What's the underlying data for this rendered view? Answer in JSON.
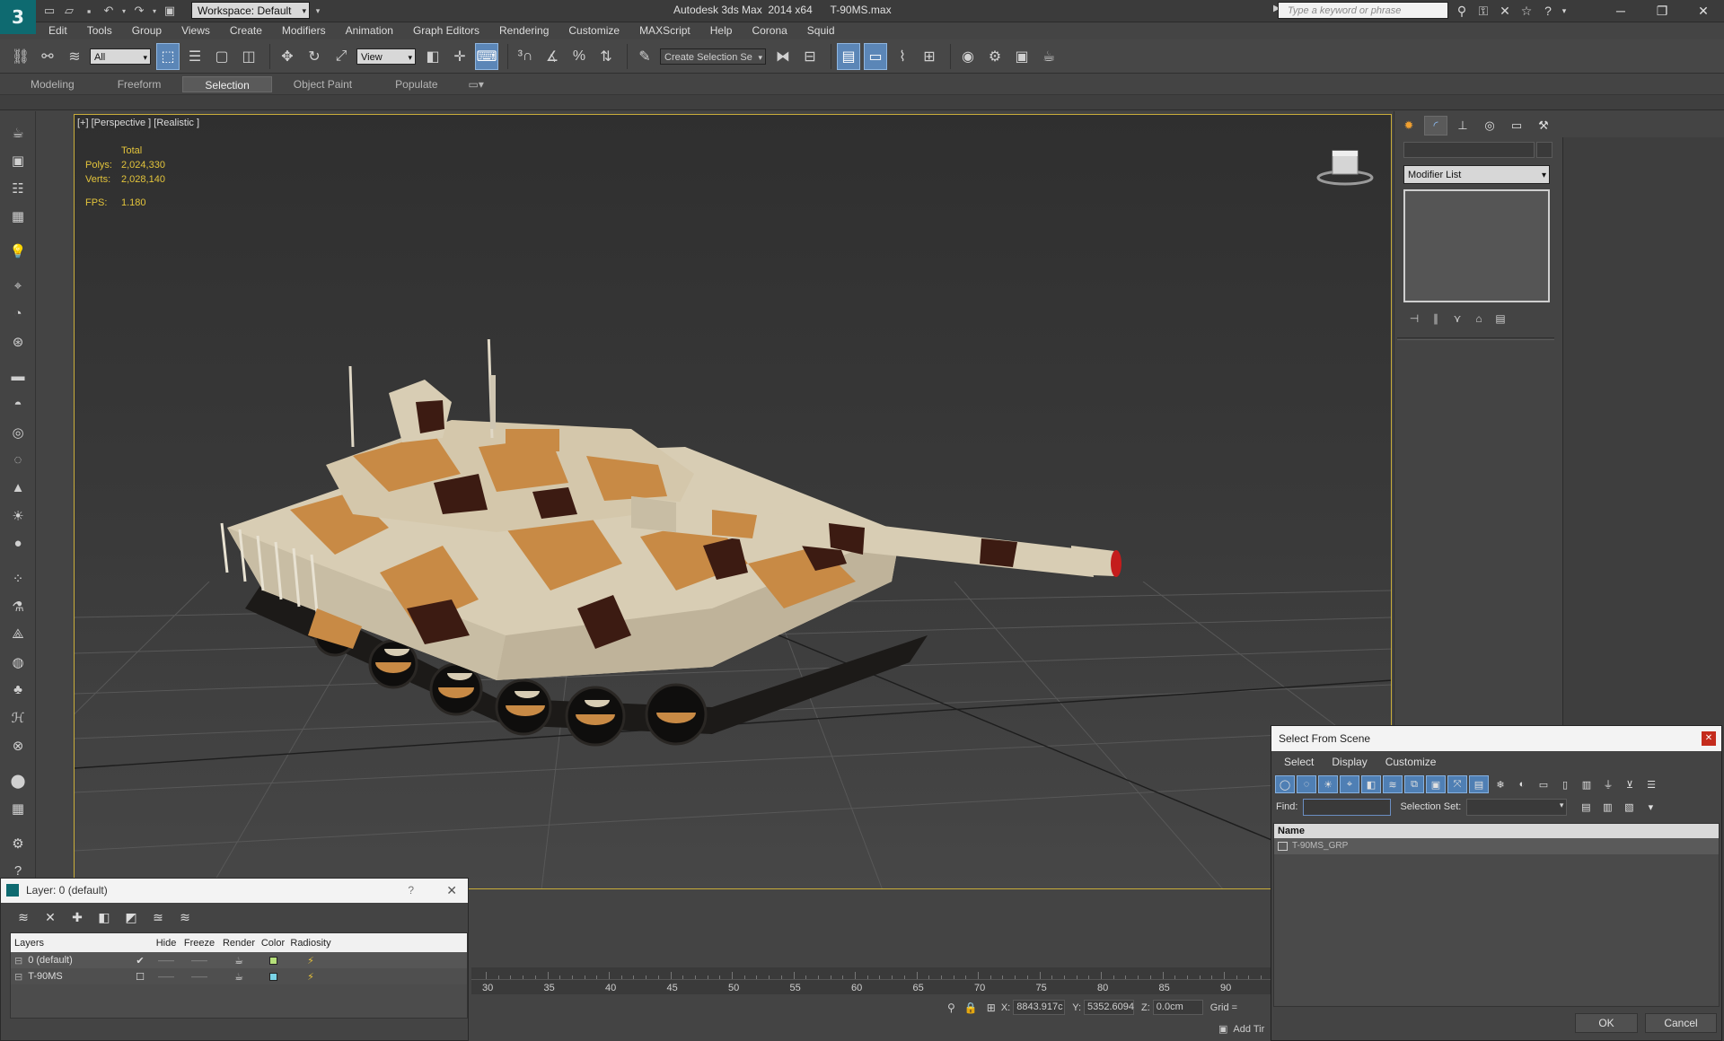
{
  "titlebar": {
    "workspace": "Workspace: Default",
    "title": "Autodesk 3ds Max  2014 x64      T-90MS.max",
    "search_placeholder": "Type a keyword or phrase"
  },
  "menu": [
    "Edit",
    "Tools",
    "Group",
    "Views",
    "Create",
    "Modifiers",
    "Animation",
    "Graph Editors",
    "Rendering",
    "Customize",
    "MAXScript",
    "Help",
    "Corona",
    "Squid"
  ],
  "toolbar": {
    "selection_filter": "All",
    "ref_coord": "View",
    "named_selection_placeholder": "Create Selection Se"
  },
  "ribbon": {
    "tabs": [
      "Modeling",
      "Freeform",
      "Selection",
      "Object Paint",
      "Populate"
    ],
    "active_tab": "Selection"
  },
  "viewport": {
    "label": "[+] [Perspective ] [Realistic ]",
    "stats": {
      "header": "Total",
      "polys_label": "Polys:",
      "polys_value": "2,024,330",
      "verts_label": "Verts:",
      "verts_value": "2,028,140",
      "fps_label": "FPS:",
      "fps_value": "1.180"
    }
  },
  "command_panel": {
    "modifier_list": "Modifier List"
  },
  "layer_dialog": {
    "title": "Layer: 0 (default)",
    "help": "?",
    "columns": [
      "Layers",
      "",
      "Hide",
      "Freeze",
      "Render",
      "Color",
      "Radiosity"
    ],
    "rows": [
      {
        "name": "0 (default)",
        "current": true,
        "color": "#b6e07a"
      },
      {
        "name": "T-90MS",
        "current": false,
        "color": "#7ad3e6"
      }
    ]
  },
  "timeline": {
    "ticks": [
      "30",
      "35",
      "40",
      "45",
      "50",
      "55",
      "60",
      "65",
      "70",
      "75",
      "80",
      "85",
      "90"
    ]
  },
  "status": {
    "x_label": "X:",
    "x_value": "8843.917c",
    "y_label": "Y:",
    "y_value": "5352.6094",
    "z_label": "Z:",
    "z_value": "0.0cm",
    "grid_label": "Grid =",
    "add_time_tag": "Add Tir"
  },
  "select_from_scene": {
    "title": "Select From Scene",
    "menu": [
      "Select",
      "Display",
      "Customize"
    ],
    "find_label": "Find:",
    "selection_set_label": "Selection Set:",
    "list_header": "Name",
    "items": [
      "T-90MS_GRP"
    ],
    "ok": "OK",
    "cancel": "Cancel"
  },
  "colors": {
    "viewport_border": "#c9ad3a",
    "stats_text": "#e3c43b",
    "accent_blue": "#5b86b7",
    "camo_light": "#d8cdb4",
    "camo_tan": "#c88a45",
    "camo_dark": "#3c1b12"
  }
}
